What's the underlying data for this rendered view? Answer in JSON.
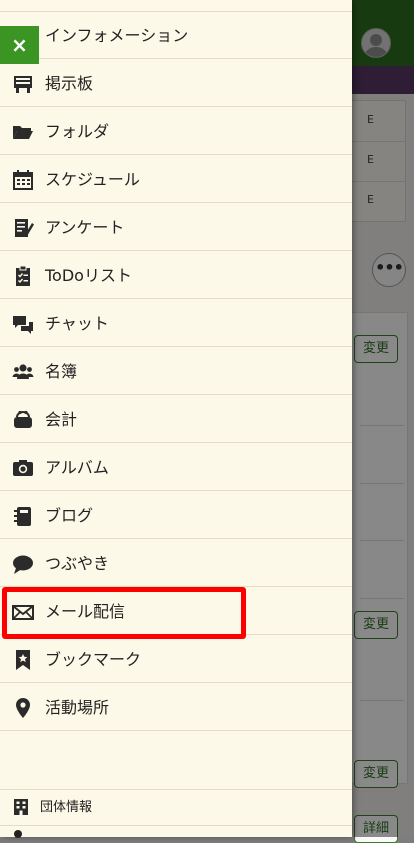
{
  "background": {
    "box_chars": [
      "E",
      "E",
      "E"
    ],
    "more_label": "•••",
    "buttons": [
      "変更",
      "変更",
      "変更",
      "詳細"
    ]
  },
  "drawer": {
    "close_label": "×",
    "items": [
      {
        "label": "インフォメーション",
        "icon": "info-icon"
      },
      {
        "label": "掲示板",
        "icon": "bulletin-board-icon"
      },
      {
        "label": "フォルダ",
        "icon": "folder-icon"
      },
      {
        "label": "スケジュール",
        "icon": "calendar-icon"
      },
      {
        "label": "アンケート",
        "icon": "survey-icon"
      },
      {
        "label": "ToDoリスト",
        "icon": "todo-clipboard-icon"
      },
      {
        "label": "チャット",
        "icon": "chat-icon"
      },
      {
        "label": "名簿",
        "icon": "members-icon"
      },
      {
        "label": "会計",
        "icon": "wallet-icon"
      },
      {
        "label": "アルバム",
        "icon": "camera-icon"
      },
      {
        "label": "ブログ",
        "icon": "blog-notebook-icon"
      },
      {
        "label": "つぶやき",
        "icon": "speech-bubble-icon"
      },
      {
        "label": "メール配信",
        "icon": "envelope-icon"
      },
      {
        "label": "ブックマーク",
        "icon": "bookmark-icon"
      },
      {
        "label": "活動場所",
        "icon": "location-pin-icon"
      }
    ],
    "footer": {
      "label": "団体情報",
      "icon": "building-icon"
    }
  },
  "colors": {
    "drawer_bg": "#fdf9e8",
    "close_button": "#3b9523",
    "highlight": "#ff0000",
    "header_green": "#2d6a1f",
    "header_purple": "#54355f"
  }
}
